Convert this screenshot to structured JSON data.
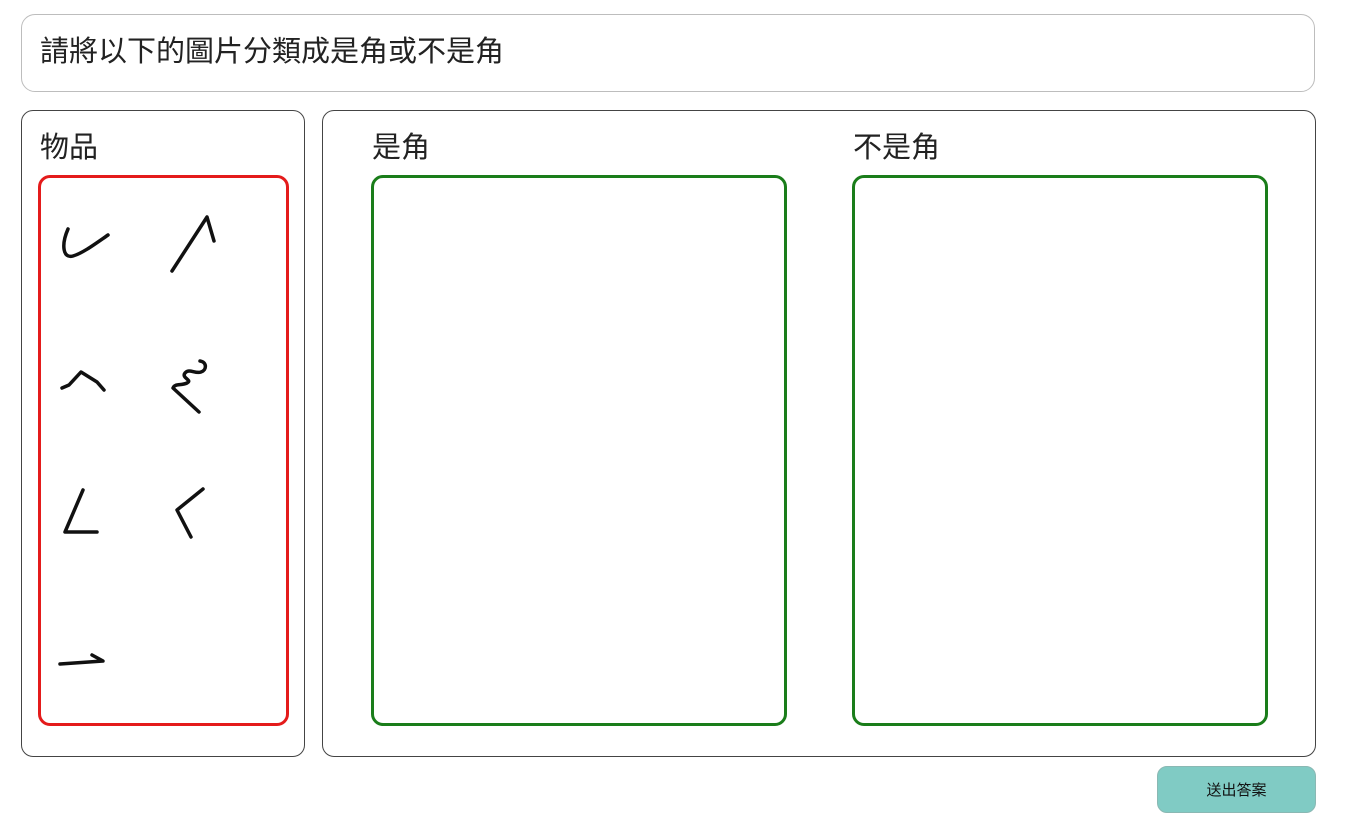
{
  "question": {
    "text": "請將以下的圖片分類成是角或不是角"
  },
  "items_panel": {
    "title": "物品",
    "items": [
      {
        "icon": "curved-u-shape-icon"
      },
      {
        "icon": "sharp-angle-up-icon"
      },
      {
        "icon": "caret-angle-icon"
      },
      {
        "icon": "wavy-line-icon"
      },
      {
        "icon": "acute-angle-icon"
      },
      {
        "icon": "less-than-angle-icon"
      },
      {
        "icon": "small-angle-icon"
      }
    ]
  },
  "categories": [
    {
      "title": "是角"
    },
    {
      "title": "不是角"
    }
  ],
  "actions": {
    "submit_label": "送出答案"
  },
  "colors": {
    "items_zone_border": "#e41b1b",
    "drop_zone_border": "#1a7d1a",
    "submit_background": "#80cbc4"
  }
}
